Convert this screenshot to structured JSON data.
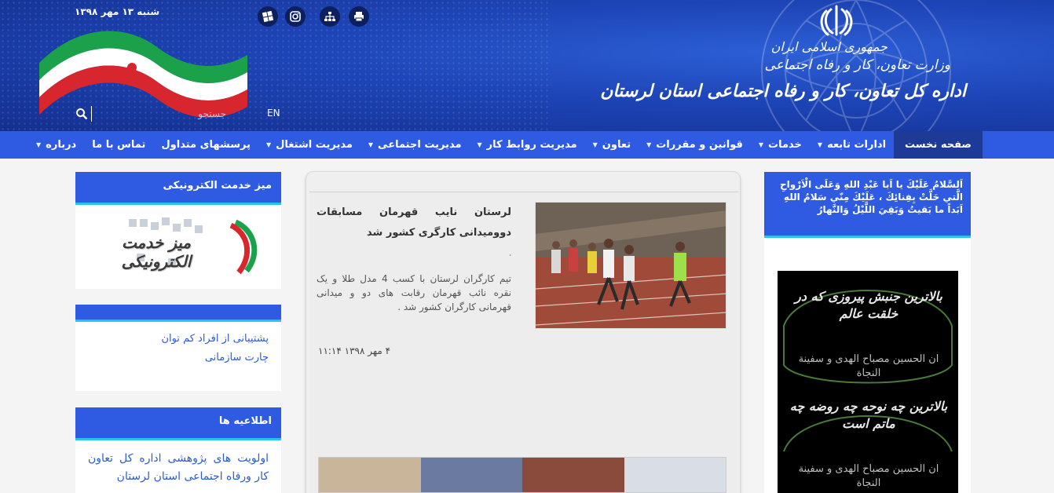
{
  "header": {
    "date": "شنبه ۱۳ مهر ۱۳۹۸",
    "lang_switch": "EN",
    "search_placeholder": "جستجو",
    "title_line1": "جمهوری اسلامی ایران",
    "title_line2": "وزارت تعاون، کار و رفاه اجتماعی",
    "title_line3": "اداره کل تعاون، کار و رفاه اجتماعی استان لرستان",
    "icons": [
      "print-icon",
      "sitemap-icon",
      "instagram-icon",
      "windows-icon"
    ]
  },
  "nav": {
    "items": [
      {
        "label": "صفحه نخست",
        "dropdown": false
      },
      {
        "label": "ادارات تابعه",
        "dropdown": true
      },
      {
        "label": "خدمات",
        "dropdown": true
      },
      {
        "label": "قوانین و مقررات",
        "dropdown": true
      },
      {
        "label": "تعاون",
        "dropdown": true
      },
      {
        "label": "مدیریت روابط کار",
        "dropdown": true
      },
      {
        "label": "مدیریت اجتماعی",
        "dropdown": true
      },
      {
        "label": "مدیریت اشتغال",
        "dropdown": true
      },
      {
        "label": "پرسشهای متداول",
        "dropdown": false
      },
      {
        "label": "تماس با ما",
        "dropdown": false
      },
      {
        "label": "درباره",
        "dropdown": true
      }
    ]
  },
  "left": {
    "eservice_title": "میز خدمت الکترونیکی",
    "eservice_image_text": "میز خدمت الکترونیکی",
    "links": [
      "پشتیبانی از افراد کم توان",
      "چارت سازمانی"
    ],
    "notices_title": "اطلاعیه ها",
    "notice_item": "اولویت های پژوهشی اداره کل تعاون کار ورفاه اجتماعی استان لرستان"
  },
  "news": {
    "title": "لرستان نایب قهرمان مسابقات دوومیدانی کارگری کشور شد",
    "separator": "،",
    "summary": "تیم کارگران لرستان با کسب 4 مدل طلا و یک نقره نائب قهرمان رقابت های دو و میدانی قهرمانی کارگران کشور شد .",
    "date": "۴ مهر ۱۳۹۸ ۱۱:۱۴"
  },
  "right": {
    "ziyarat_text": "اَلسَّلامُ عَلَيْكَ يا اَبا عَبْدِ اللهِ وَعَلَى الْاَرْواحِ الَّتي حَلَّتْ بِفِنائِكَ ، عَلَيْكَ مِنّي سَلامُ اللهِ اَبَداً ما بَقيتُ وَبَقِيَ اللَّيْلُ وَالنَّهارُ",
    "banner_line1": "بالاترین جنبش پیروزی که در خلقت عالم",
    "banner_line2": "ان الحسین مصباح الهدی و سفینة النجاة",
    "banner_line3": "بالاترین چه نوحه چه روضه چه ماتم است",
    "banner_line4": "ان الحسین مصباح الهدی و سفینة النجاة"
  },
  "colors": {
    "header_bg": "#1d44b6",
    "nav_bg": "#2f5be2",
    "nav_active": "#1c3a96",
    "accent_line": "#29c3ef",
    "link": "#2d5bd6"
  }
}
